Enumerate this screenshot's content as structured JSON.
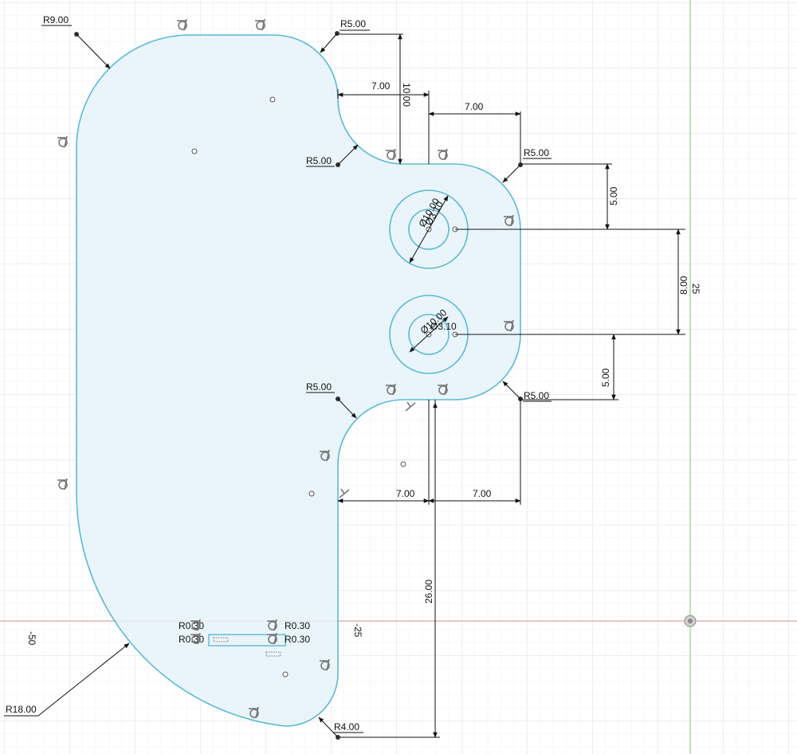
{
  "sketch": {
    "axis_labels": {
      "x_neg50": "-50",
      "x_neg25": "-25",
      "y_25": "25"
    },
    "colors": {
      "grid_minor": "#eef0f3",
      "grid_major": "#d9dde2",
      "x_axis": "#d9a79c",
      "y_axis": "#8fd08c",
      "profile_stroke": "#5bb8d6",
      "profile_fill": "#e6f3fa",
      "dimension": "#111111",
      "constraint_icon": "#777777"
    },
    "radius_dimensions": [
      {
        "text": "R9.00"
      },
      {
        "text": "R5.00"
      },
      {
        "text": "R5.00"
      },
      {
        "text": "R5.00"
      },
      {
        "text": "R5.00"
      },
      {
        "text": "R5.00"
      },
      {
        "text": "R18.00"
      },
      {
        "text": "R4.00"
      }
    ],
    "linear_dimensions": [
      {
        "text": "7.00"
      },
      {
        "text": "7.00"
      },
      {
        "text": "10.00"
      },
      {
        "text": "5.00"
      },
      {
        "text": "8.00"
      },
      {
        "text": "5.00"
      },
      {
        "text": "7.00"
      },
      {
        "text": "7.00"
      },
      {
        "text": "26.00"
      }
    ],
    "diameter_dimensions": [
      {
        "text": "Ø10.00"
      },
      {
        "text": "Ø3.10"
      },
      {
        "text": "Ø10.00"
      },
      {
        "text": "Ø3.10"
      }
    ],
    "small_dimensions": [
      {
        "text": "R0.30"
      },
      {
        "text": "R0.30"
      },
      {
        "text": "R0.30"
      },
      {
        "text": "R0.30"
      }
    ],
    "icons": {
      "tangent_constraint": "tangent-constraint-icon",
      "perpendicular_constraint": "perpendicular-constraint-icon",
      "origin": "origin-icon"
    }
  }
}
